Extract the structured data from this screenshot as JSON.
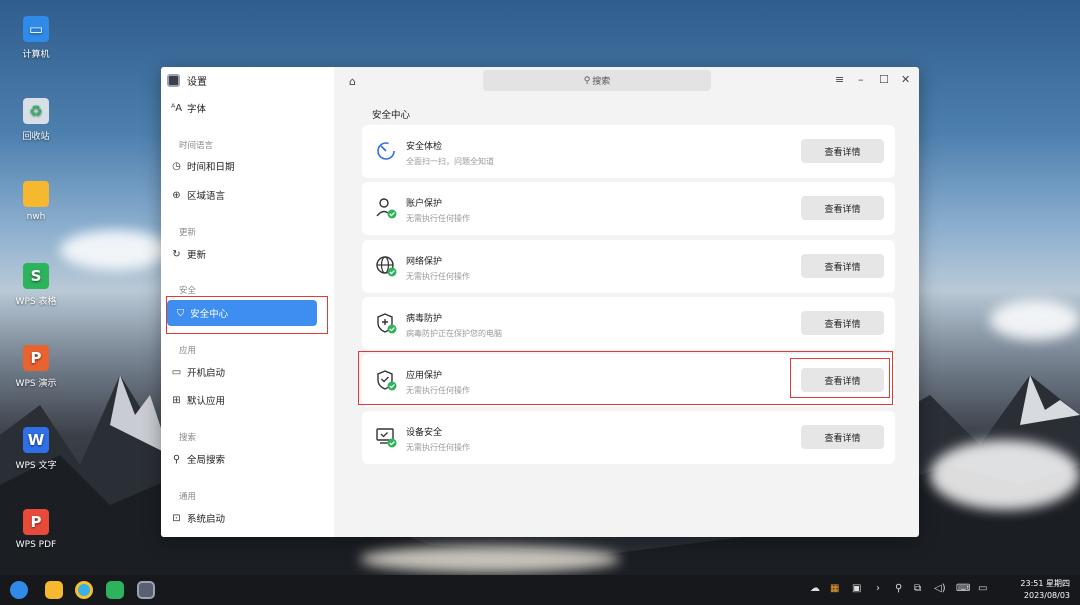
{
  "desktop": {
    "icons": [
      {
        "label": "计算机",
        "icon": "computer-icon",
        "color": "#2f8ae8"
      },
      {
        "label": "回收站",
        "icon": "trash-icon",
        "color": "#d8dfe6"
      },
      {
        "label": "nwh",
        "icon": "folder-icon",
        "color": "#f5b82e"
      },
      {
        "label": "WPS 表格",
        "icon": "wps-sheet-icon",
        "color": "#2db35b"
      },
      {
        "label": "WPS 演示",
        "icon": "wps-slides-icon",
        "color": "#e8632f"
      },
      {
        "label": "WPS 文字",
        "icon": "wps-writer-icon",
        "color": "#2f6fe8"
      },
      {
        "label": "WPS PDF",
        "icon": "wps-pdf-icon",
        "color": "#e84a3a"
      }
    ]
  },
  "window": {
    "app_title": "设置",
    "search_placeholder": "搜索",
    "controls": {
      "menu": "≡",
      "minimize": "–",
      "maximize": "☐",
      "close": "✕"
    }
  },
  "sidebar": {
    "top_item": "字体",
    "groups": [
      {
        "title": "时间语言",
        "items": [
          "时间和日期",
          "区域语言"
        ]
      },
      {
        "title": "更新",
        "items": [
          "更新"
        ]
      },
      {
        "title": "安全",
        "items": [
          "安全中心"
        ]
      },
      {
        "title": "应用",
        "items": [
          "开机启动",
          "默认应用"
        ]
      },
      {
        "title": "搜索",
        "items": [
          "全局搜索"
        ]
      },
      {
        "title": "通用",
        "items": [
          "系统启动"
        ]
      }
    ]
  },
  "main": {
    "section_title": "安全中心",
    "button_label": "查看详情",
    "cards": [
      {
        "title": "安全体检",
        "subtitle": "全面扫一扫，问题全知道",
        "icon": "scan-icon"
      },
      {
        "title": "账户保护",
        "subtitle": "无需执行任何操作",
        "icon": "account-shield-icon"
      },
      {
        "title": "网络保护",
        "subtitle": "无需执行任何操作",
        "icon": "network-shield-icon"
      },
      {
        "title": "病毒防护",
        "subtitle": "病毒防护正在保护您的电脑",
        "icon": "virus-shield-icon"
      },
      {
        "title": "应用保护",
        "subtitle": "无需执行任何操作",
        "icon": "app-shield-icon"
      },
      {
        "title": "设备安全",
        "subtitle": "无需执行任何操作",
        "icon": "device-shield-icon"
      }
    ]
  },
  "taskbar": {
    "time": "23:51 星期四",
    "date": "2023/08/03",
    "accent": "#3d8ef0"
  }
}
